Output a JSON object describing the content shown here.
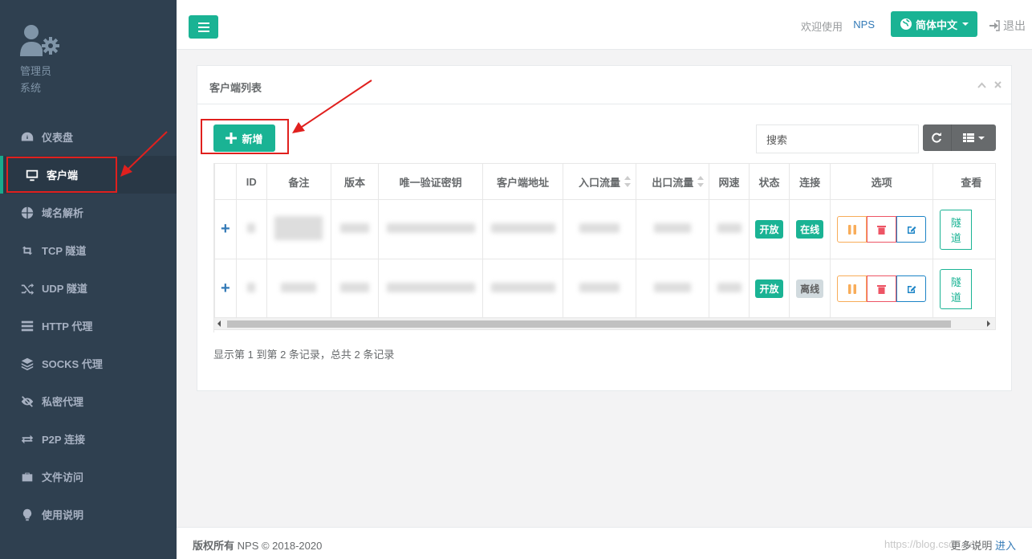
{
  "sidebar": {
    "profile": {
      "line1": "管理员",
      "line2": "系统"
    },
    "items": [
      {
        "label": "仪表盘",
        "icon": "dashboard-icon"
      },
      {
        "label": "客户端",
        "icon": "monitor-icon"
      },
      {
        "label": "域名解析",
        "icon": "globe-icon"
      },
      {
        "label": "TCP 隧道",
        "icon": "retweet-icon"
      },
      {
        "label": "UDP 隧道",
        "icon": "random-icon"
      },
      {
        "label": "HTTP 代理",
        "icon": "server-icon"
      },
      {
        "label": "SOCKS 代理",
        "icon": "layers-icon"
      },
      {
        "label": "私密代理",
        "icon": "eye-slash-icon"
      },
      {
        "label": "P2P 连接",
        "icon": "exchange-icon"
      },
      {
        "label": "文件访问",
        "icon": "briefcase-icon"
      },
      {
        "label": "使用说明",
        "icon": "lightbulb-icon"
      }
    ]
  },
  "header": {
    "welcome": "欢迎使用",
    "brand": "NPS",
    "language": "简体中文",
    "logout": "退出"
  },
  "panel": {
    "title": "客户端列表",
    "add_label": "新增",
    "search_placeholder": "搜索"
  },
  "table": {
    "columns": [
      "ID",
      "备注",
      "版本",
      "唯一验证密钥",
      "客户端地址",
      "入口流量",
      "出口流量",
      "网速",
      "状态",
      "连接",
      "选项",
      "查看"
    ],
    "rows": [
      {
        "status": "开放",
        "connection": "在线",
        "tunnel": "隧道"
      },
      {
        "status": "开放",
        "connection": "离线",
        "tunnel": "隧道"
      }
    ]
  },
  "pagination_info": "显示第 1 到第 2 条记录，总共 2 条记录",
  "footer": {
    "copyright_label": "版权所有",
    "copyright_text": "NPS © 2018-2020",
    "more_label": "更多说明",
    "more_link": "进入",
    "watermark": "https://blog.csdn.net/"
  },
  "colors": {
    "sidebar_bg": "#2f4050",
    "accent": "#1ab394",
    "annotation": "#e0201e"
  }
}
